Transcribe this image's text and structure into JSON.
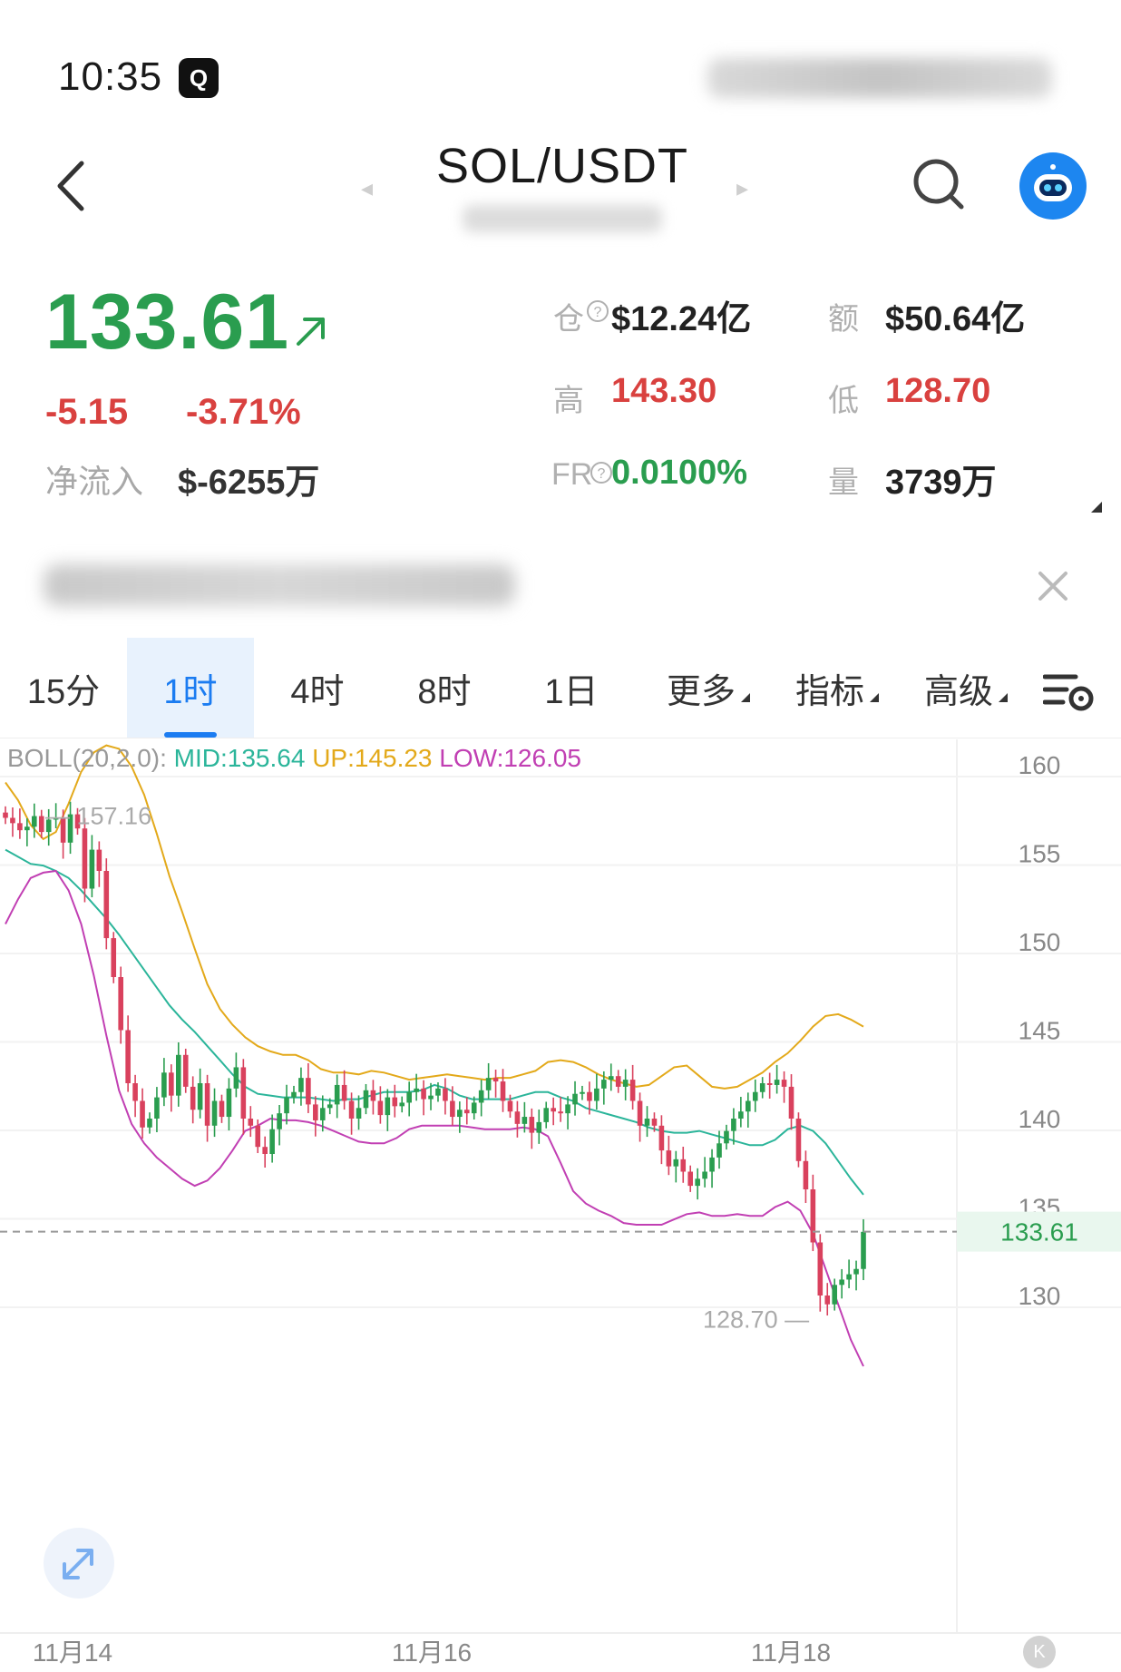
{
  "status_bar": {
    "time": "10:35",
    "app_icon_text": "Q"
  },
  "header": {
    "pair": "SOL/USDT",
    "prev_arrow": "◂",
    "next_arrow": "▸",
    "icons": [
      "back-icon",
      "search-icon",
      "bot-avatar-icon"
    ]
  },
  "price": {
    "last": "133.61",
    "change_abs": "-5.15",
    "change_pct": "-3.71%",
    "netflow_label": "净流入",
    "netflow_value": "$-6255万"
  },
  "stats": {
    "oi_label": "仓",
    "oi_value": "$12.24亿",
    "turnover_label": "额",
    "turnover_value": "$50.64亿",
    "high_label": "高",
    "high_value": "143.30",
    "low_label": "低",
    "low_value": "128.70",
    "fr_label": "FR",
    "fr_value": "0.0100%",
    "volume_label": "量",
    "volume_value": "3739万"
  },
  "tabs": {
    "items": [
      {
        "label": "15分",
        "active": false,
        "dropdown": false
      },
      {
        "label": "1时",
        "active": true,
        "dropdown": false
      },
      {
        "label": "4时",
        "active": false,
        "dropdown": false
      },
      {
        "label": "8时",
        "active": false,
        "dropdown": false
      },
      {
        "label": "1日",
        "active": false,
        "dropdown": false
      },
      {
        "label": "更多",
        "active": false,
        "dropdown": true
      },
      {
        "label": "指标",
        "active": false,
        "dropdown": true
      },
      {
        "label": "高级",
        "active": false,
        "dropdown": true
      }
    ]
  },
  "indicator": {
    "name": "BOLL(20,2.0):",
    "mid": "MID:135.64",
    "up": "UP:145.23",
    "low": "LOW:126.05"
  },
  "colors": {
    "price_green": "#2a9d4f",
    "price_red": "#d9413f",
    "accent_blue": "#1b7cf1",
    "boll_mid": "#2bb59a",
    "boll_up": "#e3a91a",
    "boll_low": "#c13fb3",
    "candle_up": "#2a9d4f",
    "candle_down": "#d9415d"
  },
  "chart_data": {
    "type": "candlestick",
    "ylim": [
      125,
      162
    ],
    "y_ticks": [
      160,
      155,
      150,
      145,
      140,
      135,
      130
    ],
    "x_labels": [
      "11月14",
      "11月16",
      "11月18"
    ],
    "current_price_label": "133.61",
    "max_marker": "157.16",
    "min_marker": "128.70",
    "candle_count": 120,
    "close": [
      157.0,
      156.7,
      156.3,
      156.5,
      157.1,
      156.2,
      156.9,
      157.0,
      155.6,
      157.2,
      156.4,
      153.0,
      155.2,
      154.0,
      150.2,
      148.0,
      145.0,
      142.0,
      141.0,
      139.5,
      140.0,
      141.2,
      142.6,
      141.3,
      143.6,
      141.8,
      140.5,
      142.0,
      139.6,
      141.0,
      140.1,
      141.7,
      142.9,
      140.0,
      139.6,
      138.4,
      138.0,
      139.4,
      140.3,
      141.2,
      141.5,
      142.3,
      140.8,
      139.9,
      140.6,
      140.8,
      141.9,
      141.0,
      140.0,
      140.6,
      141.6,
      141.0,
      140.2,
      141.2,
      140.7,
      140.9,
      141.5,
      141.7,
      141.1,
      141.3,
      141.7,
      141.0,
      140.1,
      140.5,
      140.3,
      140.9,
      141.6,
      142.3,
      142.1,
      141.0,
      140.4,
      139.7,
      140.1,
      139.2,
      139.8,
      140.6,
      140.4,
      140.3,
      140.8,
      141.4,
      141.5,
      141.0,
      141.7,
      142.2,
      142.4,
      141.8,
      142.2,
      141.0,
      139.6,
      140.0,
      139.6,
      138.2,
      137.3,
      137.7,
      137.0,
      136.2,
      136.6,
      137.0,
      137.8,
      138.6,
      139.3,
      140.0,
      140.4,
      141.0,
      141.5,
      142.0,
      141.9,
      142.2,
      141.8,
      140.0,
      137.6,
      136.0,
      133.0,
      130.0,
      129.5,
      130.6,
      130.9,
      131.2,
      131.5,
      133.6
    ],
    "boll_up": [
      159.0,
      158.0,
      156.6,
      155.8,
      156.2,
      157.8,
      159.6,
      160.7,
      161.1,
      160.9,
      159.9,
      158.3,
      156.1,
      153.7,
      151.7,
      149.6,
      147.6,
      146.2,
      145.3,
      144.6,
      144.1,
      143.8,
      143.6,
      143.6,
      143.3,
      142.8,
      142.6,
      142.6,
      142.5,
      142.7,
      142.6,
      142.4,
      142.2,
      142.3,
      142.4,
      142.5,
      142.4,
      142.3,
      142.2,
      142.3,
      142.3,
      142.5,
      142.7,
      143.2,
      143.3,
      143.2,
      142.9,
      142.5,
      142.2,
      142.0,
      141.8,
      141.9,
      142.4,
      142.9,
      143.0,
      142.4,
      141.8,
      141.7,
      141.8,
      142.2,
      142.6,
      143.2,
      143.7,
      144.4,
      145.2,
      145.8,
      145.9,
      145.6,
      145.2
    ],
    "boll_mid": [
      155.2,
      154.8,
      154.4,
      154.3,
      154.0,
      153.6,
      152.9,
      152.1,
      151.3,
      150.4,
      149.4,
      148.4,
      147.4,
      146.4,
      145.6,
      144.9,
      144.1,
      143.3,
      142.5,
      141.8,
      141.4,
      141.3,
      141.2,
      141.2,
      141.2,
      141.1,
      141.0,
      141.1,
      141.1,
      141.3,
      141.5,
      141.5,
      141.5,
      141.6,
      141.9,
      141.7,
      141.3,
      141.1,
      141.1,
      141.1,
      141.1,
      141.3,
      141.5,
      141.5,
      141.2,
      141.0,
      140.6,
      140.4,
      140.2,
      140.0,
      139.8,
      139.5,
      139.3,
      139.2,
      139.2,
      139.3,
      139.1,
      138.9,
      138.7,
      138.5,
      138.5,
      138.8,
      139.4,
      139.6,
      139.3,
      138.6,
      137.6,
      136.6,
      135.7
    ],
    "boll_low": [
      151.0,
      152.4,
      153.6,
      153.9,
      154.0,
      152.9,
      151.0,
      148.1,
      144.7,
      141.6,
      139.7,
      138.6,
      137.8,
      137.2,
      136.6,
      136.2,
      136.5,
      137.2,
      138.2,
      139.3,
      139.6,
      140.0,
      139.9,
      139.9,
      139.8,
      139.6,
      139.3,
      139.0,
      138.7,
      138.6,
      138.6,
      138.9,
      139.4,
      139.6,
      139.6,
      139.6,
      139.6,
      139.5,
      139.4,
      139.4,
      139.4,
      139.5,
      139.4,
      139.0,
      137.5,
      135.9,
      135.2,
      134.8,
      134.5,
      134.1,
      134.0,
      134.0,
      134.0,
      134.3,
      134.6,
      134.7,
      134.5,
      134.5,
      134.6,
      134.5,
      134.5,
      135.0,
      135.3,
      134.8,
      133.5,
      131.5,
      129.5,
      127.5,
      126.0
    ]
  }
}
